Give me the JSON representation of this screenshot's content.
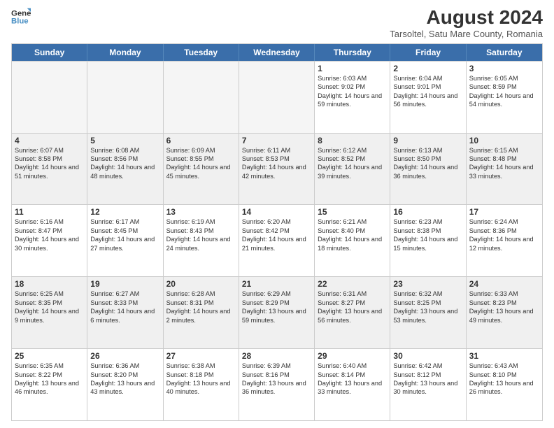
{
  "header": {
    "logo_line1": "General",
    "logo_line2": "Blue",
    "month_year": "August 2024",
    "location": "Tarsoltel, Satu Mare County, Romania"
  },
  "days_of_week": [
    "Sunday",
    "Monday",
    "Tuesday",
    "Wednesday",
    "Thursday",
    "Friday",
    "Saturday"
  ],
  "rows": [
    {
      "cells": [
        {
          "day": "",
          "info": "",
          "empty": true
        },
        {
          "day": "",
          "info": "",
          "empty": true
        },
        {
          "day": "",
          "info": "",
          "empty": true
        },
        {
          "day": "",
          "info": "",
          "empty": true
        },
        {
          "day": "1",
          "info": "Sunrise: 6:03 AM\nSunset: 9:02 PM\nDaylight: 14 hours and 59 minutes."
        },
        {
          "day": "2",
          "info": "Sunrise: 6:04 AM\nSunset: 9:01 PM\nDaylight: 14 hours and 56 minutes."
        },
        {
          "day": "3",
          "info": "Sunrise: 6:05 AM\nSunset: 8:59 PM\nDaylight: 14 hours and 54 minutes."
        }
      ]
    },
    {
      "cells": [
        {
          "day": "4",
          "info": "Sunrise: 6:07 AM\nSunset: 8:58 PM\nDaylight: 14 hours and 51 minutes."
        },
        {
          "day": "5",
          "info": "Sunrise: 6:08 AM\nSunset: 8:56 PM\nDaylight: 14 hours and 48 minutes."
        },
        {
          "day": "6",
          "info": "Sunrise: 6:09 AM\nSunset: 8:55 PM\nDaylight: 14 hours and 45 minutes."
        },
        {
          "day": "7",
          "info": "Sunrise: 6:11 AM\nSunset: 8:53 PM\nDaylight: 14 hours and 42 minutes."
        },
        {
          "day": "8",
          "info": "Sunrise: 6:12 AM\nSunset: 8:52 PM\nDaylight: 14 hours and 39 minutes."
        },
        {
          "day": "9",
          "info": "Sunrise: 6:13 AM\nSunset: 8:50 PM\nDaylight: 14 hours and 36 minutes."
        },
        {
          "day": "10",
          "info": "Sunrise: 6:15 AM\nSunset: 8:48 PM\nDaylight: 14 hours and 33 minutes."
        }
      ]
    },
    {
      "cells": [
        {
          "day": "11",
          "info": "Sunrise: 6:16 AM\nSunset: 8:47 PM\nDaylight: 14 hours and 30 minutes."
        },
        {
          "day": "12",
          "info": "Sunrise: 6:17 AM\nSunset: 8:45 PM\nDaylight: 14 hours and 27 minutes."
        },
        {
          "day": "13",
          "info": "Sunrise: 6:19 AM\nSunset: 8:43 PM\nDaylight: 14 hours and 24 minutes."
        },
        {
          "day": "14",
          "info": "Sunrise: 6:20 AM\nSunset: 8:42 PM\nDaylight: 14 hours and 21 minutes."
        },
        {
          "day": "15",
          "info": "Sunrise: 6:21 AM\nSunset: 8:40 PM\nDaylight: 14 hours and 18 minutes."
        },
        {
          "day": "16",
          "info": "Sunrise: 6:23 AM\nSunset: 8:38 PM\nDaylight: 14 hours and 15 minutes."
        },
        {
          "day": "17",
          "info": "Sunrise: 6:24 AM\nSunset: 8:36 PM\nDaylight: 14 hours and 12 minutes."
        }
      ]
    },
    {
      "cells": [
        {
          "day": "18",
          "info": "Sunrise: 6:25 AM\nSunset: 8:35 PM\nDaylight: 14 hours and 9 minutes."
        },
        {
          "day": "19",
          "info": "Sunrise: 6:27 AM\nSunset: 8:33 PM\nDaylight: 14 hours and 6 minutes."
        },
        {
          "day": "20",
          "info": "Sunrise: 6:28 AM\nSunset: 8:31 PM\nDaylight: 14 hours and 2 minutes."
        },
        {
          "day": "21",
          "info": "Sunrise: 6:29 AM\nSunset: 8:29 PM\nDaylight: 13 hours and 59 minutes."
        },
        {
          "day": "22",
          "info": "Sunrise: 6:31 AM\nSunset: 8:27 PM\nDaylight: 13 hours and 56 minutes."
        },
        {
          "day": "23",
          "info": "Sunrise: 6:32 AM\nSunset: 8:25 PM\nDaylight: 13 hours and 53 minutes."
        },
        {
          "day": "24",
          "info": "Sunrise: 6:33 AM\nSunset: 8:23 PM\nDaylight: 13 hours and 49 minutes."
        }
      ]
    },
    {
      "cells": [
        {
          "day": "25",
          "info": "Sunrise: 6:35 AM\nSunset: 8:22 PM\nDaylight: 13 hours and 46 minutes."
        },
        {
          "day": "26",
          "info": "Sunrise: 6:36 AM\nSunset: 8:20 PM\nDaylight: 13 hours and 43 minutes."
        },
        {
          "day": "27",
          "info": "Sunrise: 6:38 AM\nSunset: 8:18 PM\nDaylight: 13 hours and 40 minutes."
        },
        {
          "day": "28",
          "info": "Sunrise: 6:39 AM\nSunset: 8:16 PM\nDaylight: 13 hours and 36 minutes."
        },
        {
          "day": "29",
          "info": "Sunrise: 6:40 AM\nSunset: 8:14 PM\nDaylight: 13 hours and 33 minutes."
        },
        {
          "day": "30",
          "info": "Sunrise: 6:42 AM\nSunset: 8:12 PM\nDaylight: 13 hours and 30 minutes."
        },
        {
          "day": "31",
          "info": "Sunrise: 6:43 AM\nSunset: 8:10 PM\nDaylight: 13 hours and 26 minutes."
        }
      ]
    }
  ]
}
